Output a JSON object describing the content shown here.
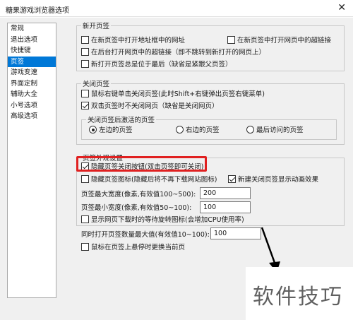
{
  "window": {
    "title": "糖果游戏浏览器选项",
    "close_glyph": "✕"
  },
  "sidebar": {
    "items": [
      {
        "label": "常规",
        "selected": false
      },
      {
        "label": "退出选项",
        "selected": false
      },
      {
        "label": "快捷键",
        "selected": false
      },
      {
        "label": "页签",
        "selected": true
      },
      {
        "label": "游戏变速",
        "selected": false
      },
      {
        "label": "界面定制",
        "selected": false
      },
      {
        "label": "辅助大全",
        "selected": false
      },
      {
        "label": "小号选项",
        "selected": false
      },
      {
        "label": "高级选项",
        "selected": false
      }
    ]
  },
  "new_tab": {
    "legend": "新开页签",
    "open_address_bar_url": {
      "label": "在新页签中打开地址框中的网址",
      "checked": false
    },
    "open_link_in_new_tab": {
      "label": "在新页签中打开网页中的超链接",
      "checked": false
    },
    "open_link_background": {
      "label": "在后台打开网页中的超链接（即不跳转到新打开的网页上）",
      "checked": false
    },
    "new_tab_at_end": {
      "label": "新打开页签总是位于最后（缺省是紧跟父页签）",
      "checked": false
    }
  },
  "close_tab": {
    "legend": "关闭页签",
    "right_click_close": {
      "label": "鼠标右键单击关闭页签(此时Shift+右键弹出页签右键菜单)",
      "checked": false
    },
    "double_click_no_close": {
      "label": "双击页签时不关闭网页（缺省是关闭网页）",
      "checked": true
    },
    "activate_group": {
      "legend": "关闭页签后激活的页签",
      "options": [
        {
          "label": "左边的页签",
          "checked": true
        },
        {
          "label": "右边的页签",
          "checked": false
        },
        {
          "label": "最后访问的页签",
          "checked": false
        }
      ]
    }
  },
  "tab_appearance": {
    "legend": "页签外观设置",
    "hide_close_button": {
      "label": "隐藏页签关闭按钮(双击页签即可关闭)",
      "checked": true
    },
    "hide_tab_icon": {
      "label": "隐藏页签图标(隐藏后将不再下载网站图标)",
      "checked": false
    },
    "close_animation": {
      "label": "新建关闭页签显示动画效果",
      "checked": true
    },
    "max_width": {
      "label": "页签最大宽度(像素,有效值100~500):",
      "value": "200"
    },
    "min_width": {
      "label": "页签最小宽度(像素,有效值50~100):",
      "value": "100"
    },
    "show_spinner": {
      "label": "显示网页下载时的等待旋转图标(会增加CPU使用率)",
      "checked": false
    }
  },
  "misc": {
    "max_open_tabs": {
      "label": "同时打开页签数量最大值(有效值10~100):",
      "value": "100"
    },
    "hover_switch": {
      "label": "鼠标在页签上悬停时更换当前页",
      "checked": false
    }
  },
  "watermark": {
    "text": "软件技巧"
  },
  "colors": {
    "selection": "#0078d7",
    "highlight": "#e02020"
  }
}
